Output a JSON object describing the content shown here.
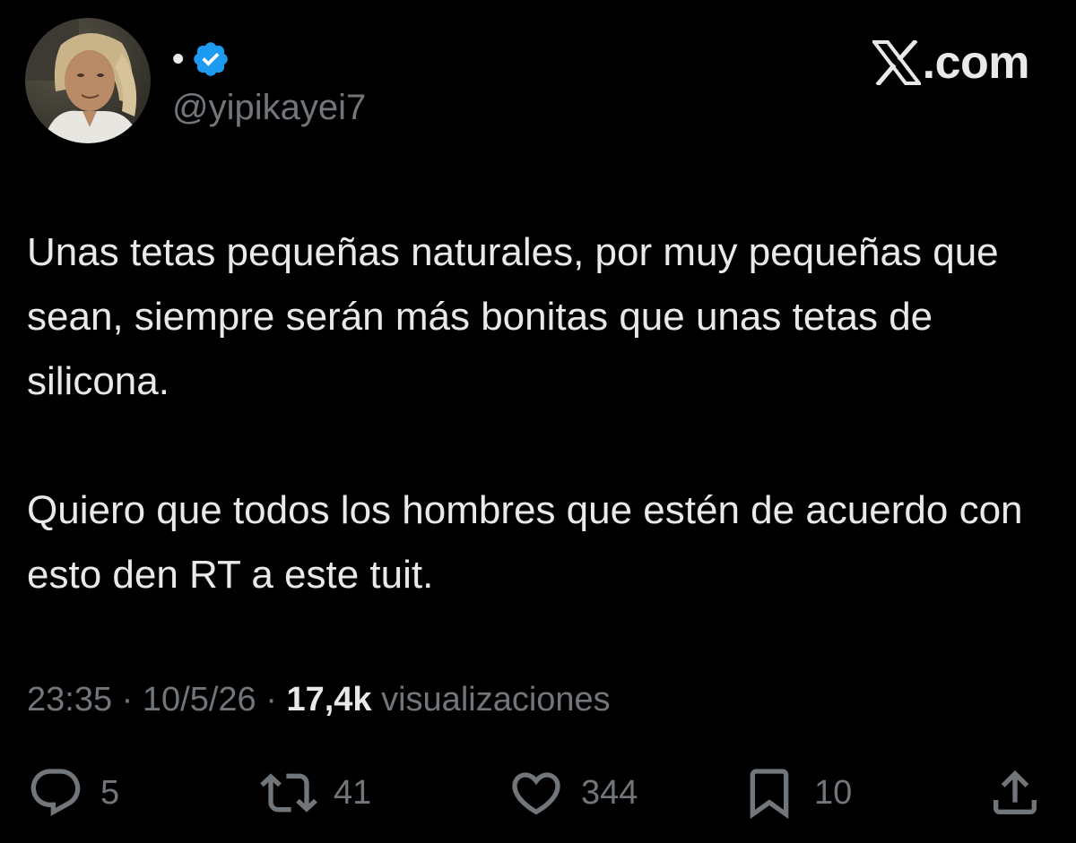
{
  "author": {
    "display_name": "•",
    "handle": "@yipikayei7",
    "verified_icon": "verified-badge-icon",
    "avatar_icon": "avatar-photo"
  },
  "brand": {
    "icon": "x-logo-icon",
    "text": ".com"
  },
  "tweet": {
    "paragraphs": [
      "Unas tetas pequeñas naturales, por muy pequeñas que sean, siempre serán más bonitas que unas tetas de silicona.",
      "Quiero que todos los hombres que estén de acuerdo con esto den RT a este tuit."
    ]
  },
  "meta": {
    "time": "23:35",
    "separator": "·",
    "date": "10/5/26",
    "views_count": "17,4k",
    "views_label": "visualizaciones"
  },
  "actions": {
    "reply": {
      "icon": "reply-icon",
      "count": "5"
    },
    "retweet": {
      "icon": "retweet-icon",
      "count": "41"
    },
    "like": {
      "icon": "heart-icon",
      "count": "344"
    },
    "bookmark": {
      "icon": "bookmark-icon",
      "count": "10"
    },
    "share": {
      "icon": "share-icon"
    }
  },
  "colors": {
    "background": "#000000",
    "text_primary": "#e7e9ea",
    "text_secondary": "#71767b",
    "verified_blue": "#1d9bf0"
  }
}
